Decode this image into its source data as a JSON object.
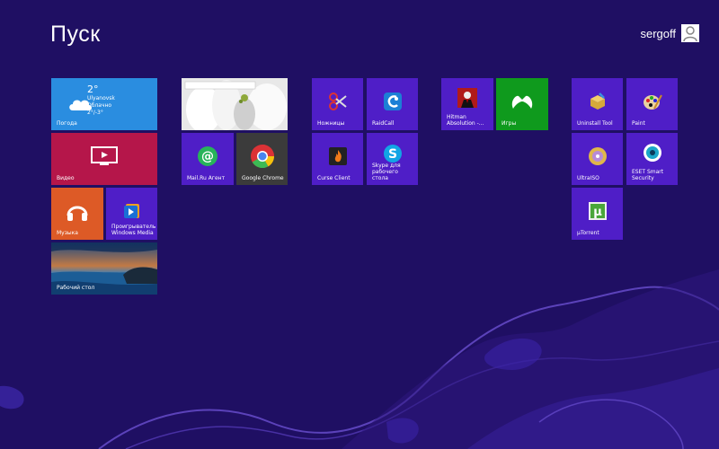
{
  "start": {
    "title": "Пуск"
  },
  "user": {
    "name": "sergoff"
  },
  "weather": {
    "temp": "2°",
    "city": "Ulyanovsk",
    "cond": "Облачно",
    "range": "2°/-3°",
    "label": "Погода"
  },
  "tiles": {
    "video": "Видео",
    "music": "Музыка",
    "media_player": "Проигрыватель Windows Media",
    "desktop": "Рабочий стол",
    "mailru": "Mail.Ru Агент",
    "chrome": "Google Chrome",
    "scissors": "Ножницы",
    "raidcall": "RaidCall",
    "curse": "Curse Client",
    "skype": "Skype для рабочего стола",
    "hitman": "Hitman Absolution -...",
    "games": "Игры",
    "uninstall": "Uninstall Tool",
    "paint": "Paint",
    "ultraiso": "UltraISO",
    "eset": "ESET Smart Security",
    "utorrent": "µTorrent"
  },
  "colors": {
    "background": "#1f0f63",
    "tile": "#4f1ec7",
    "weather": "#2a8de0",
    "video": "#b5164a",
    "music": "#dd5a26",
    "games": "#0f9a1d",
    "dark": "#2b2b2b"
  }
}
